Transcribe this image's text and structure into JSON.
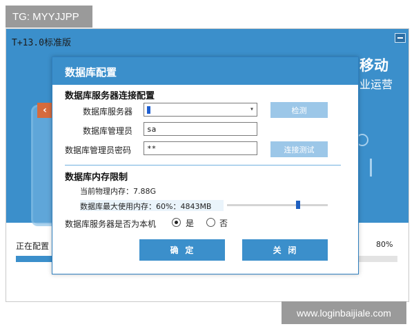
{
  "watermarks": {
    "top": "TG: MYYJJPP",
    "bottom": "www.loginbaijiale.com"
  },
  "installer": {
    "title": "T+13.0标准版",
    "promo_main": "移动",
    "promo_sub": "业运营",
    "status_text": "正在配置",
    "progress_percent": 80,
    "progress_label": "80%",
    "accent_color": "#3b8fcb"
  },
  "dialog": {
    "title": "数据库配置",
    "connection": {
      "section_title": "数据库服务器连接配置",
      "server_label": "数据库服务器",
      "server_value": "",
      "admin_label": "数据库管理员",
      "admin_value": "sa",
      "password_label": "数据库管理员密码",
      "password_value": "**",
      "detect_button": "检测",
      "test_button": "连接测试"
    },
    "memory": {
      "section_title": "数据库内存限制",
      "physical_memory": "当前物理内存：7.88G",
      "max_memory": "数据库最大使用内存：60%：4843MB",
      "slider_percent": 60
    },
    "local_server": {
      "question": "数据库服务器是否为本机",
      "options": [
        "是",
        "否"
      ],
      "selected": "是"
    },
    "buttons": {
      "ok": "确  定",
      "close": "关  闭"
    }
  }
}
